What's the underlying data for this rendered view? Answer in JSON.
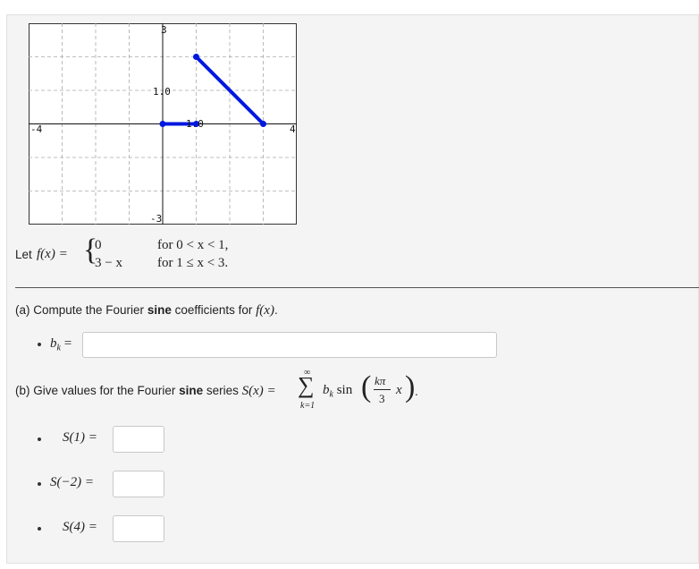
{
  "graph": {
    "x_range": [
      -4,
      4
    ],
    "y_range": [
      -3,
      3
    ],
    "grid": true,
    "labels": {
      "ymax": "3",
      "ymin": "-3",
      "xmin": "-4",
      "xmax": "4",
      "y1": "1.0",
      "x1": "1.0"
    },
    "line_color": "#0018e0",
    "segments": [
      {
        "x1": 0,
        "y1": 0,
        "x2": 1,
        "y2": 0
      },
      {
        "x1": 1,
        "y1": 2,
        "x2": 3,
        "y2": 0
      }
    ]
  },
  "function": {
    "intro": "Let",
    "name": "f(x) =",
    "case1_expr": "0",
    "case1_cond": "for 0 < x < 1,",
    "case2_expr": "3 − x",
    "case2_cond": "for 1 ≤ x < 3."
  },
  "part_a": {
    "prefix": "(a) Compute the Fourier ",
    "bold": "sine",
    "suffix": " coefficients for ",
    "fx": "f(x)",
    "end": ".",
    "bk_label": "b",
    "bk_sub": "k",
    "bk_eq": "=",
    "bk_value": ""
  },
  "part_b": {
    "prefix": "(b) Give values for the Fourier ",
    "bold": "sine",
    "suffix": " series ",
    "sx": "S(x) =",
    "sigma": "∑",
    "upper": "∞",
    "lower": "k=1",
    "term_b": "b",
    "term_sub": "k",
    "sin": "sin",
    "frac_num": "kπ",
    "frac_den": "3",
    "var_x": "x",
    "end": ".",
    "inputs": [
      {
        "label": "S(1) =",
        "value": ""
      },
      {
        "label": "S(−2) =",
        "value": ""
      },
      {
        "label": "S(4) =",
        "value": ""
      }
    ]
  }
}
